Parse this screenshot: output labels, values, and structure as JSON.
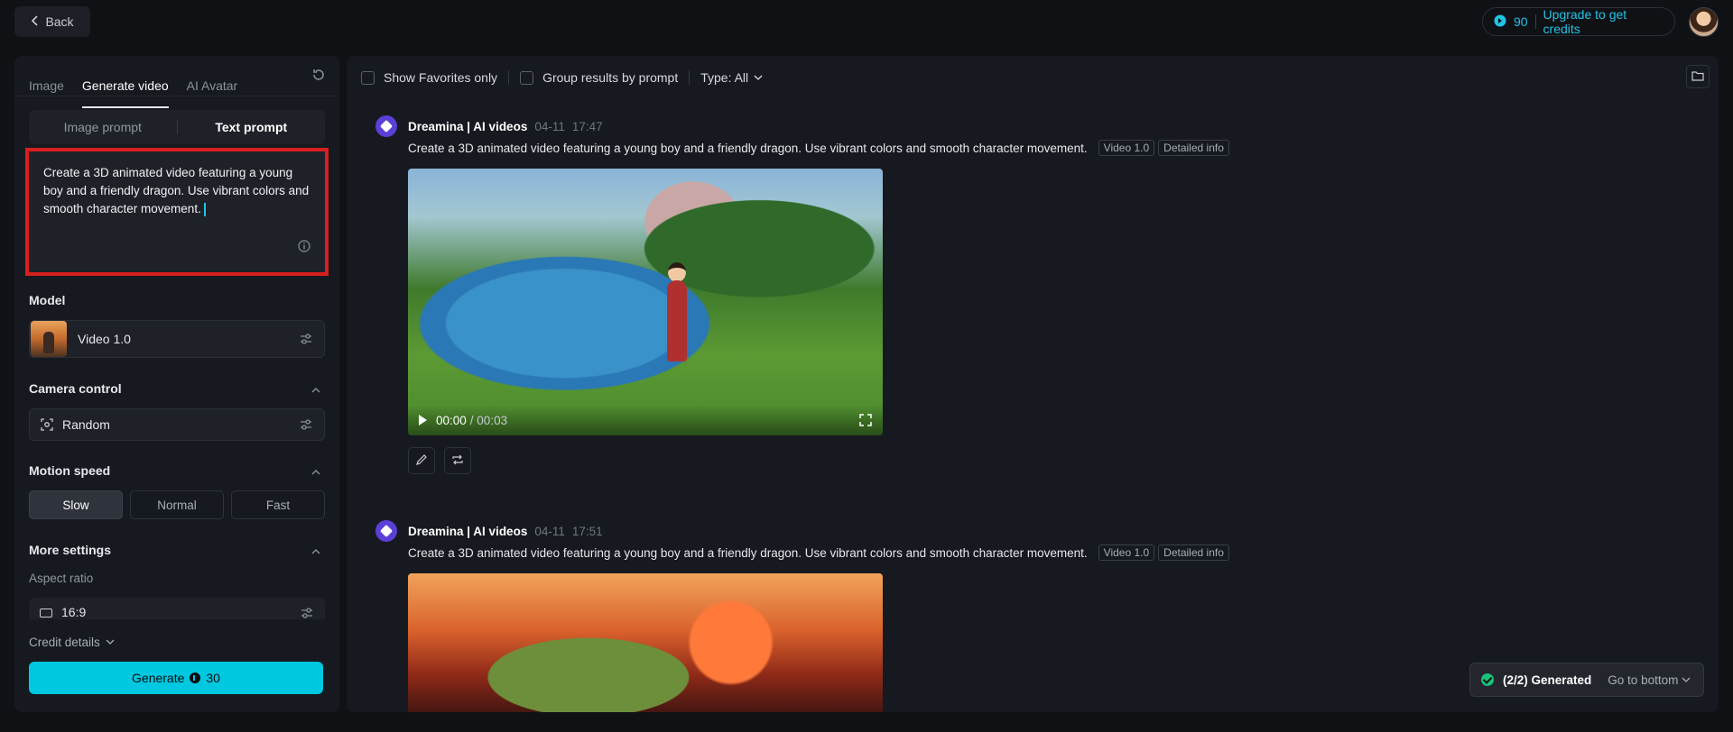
{
  "header": {
    "back_label": "Back",
    "credits_count": "90",
    "upgrade_label": "Upgrade to get credits"
  },
  "left_panel": {
    "tabs": [
      {
        "label": "Image"
      },
      {
        "label": "Generate video"
      },
      {
        "label": "AI Avatar"
      }
    ],
    "prompt_modes": [
      {
        "label": "Image prompt"
      },
      {
        "label": "Text prompt"
      }
    ],
    "prompt_text": "Create a 3D animated video featuring a young boy and a friendly dragon. Use vibrant colors and smooth character movement.",
    "model_title": "Model",
    "model_value": "Video 1.0",
    "camera_title": "Camera control",
    "camera_value": "Random",
    "motion_title": "Motion speed",
    "speed_options": [
      {
        "label": "Slow"
      },
      {
        "label": "Normal"
      },
      {
        "label": "Fast"
      }
    ],
    "more_title": "More settings",
    "aspect_label": "Aspect ratio",
    "aspect_value": "16:9",
    "credit_details": "Credit details",
    "generate_label": "Generate",
    "generate_cost": "30"
  },
  "main": {
    "filters": {
      "favorites": "Show Favorites only",
      "group": "Group results by prompt",
      "type": "Type: All"
    },
    "posts": [
      {
        "author": "Dreamina | AI videos",
        "date": "04-11",
        "time": "17:47",
        "prompt": "Create a 3D animated video featuring a young boy and a friendly dragon. Use vibrant colors and smooth character movement.",
        "tag_model": "Video 1.0",
        "tag_info": "Detailed info",
        "video_current": "00:00",
        "video_duration": "/ 00:03"
      },
      {
        "author": "Dreamina | AI videos",
        "date": "04-11",
        "time": "17:51",
        "prompt": "Create a 3D animated video featuring a young boy and a friendly dragon. Use vibrant colors and smooth character movement.",
        "tag_model": "Video 1.0",
        "tag_info": "Detailed info"
      }
    ],
    "status": {
      "generated": "(2/2) Generated",
      "go_bottom": "Go to bottom"
    }
  },
  "colors": {
    "accent": "#00c8e0",
    "highlight_border": "#d81f1f",
    "background": "#0f1115",
    "panel": "#16191f"
  }
}
